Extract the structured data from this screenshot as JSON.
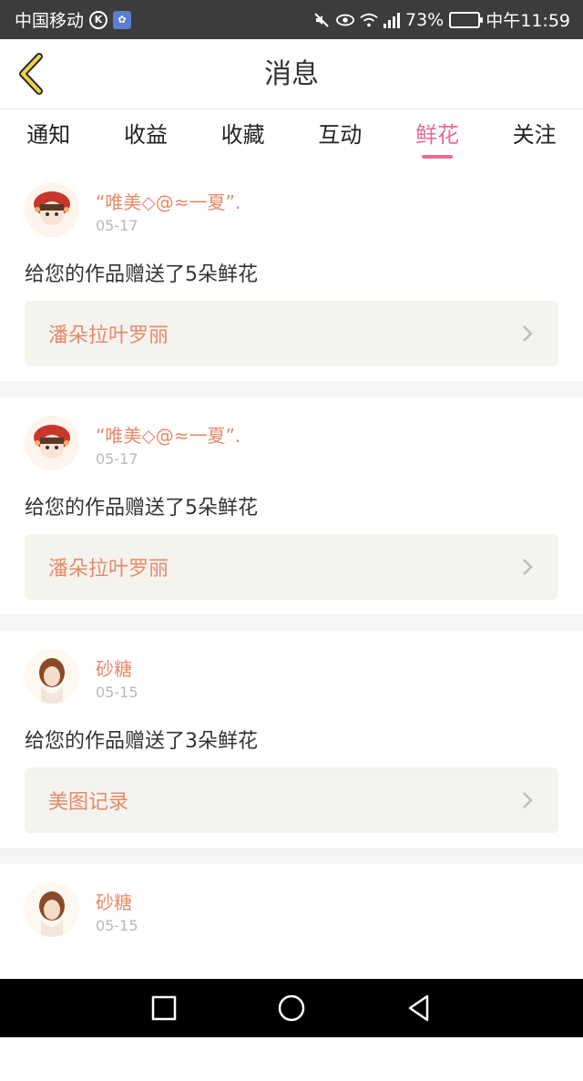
{
  "status_bar": {
    "carrier": "中国移动",
    "battery_percent": "73%",
    "battery_level": 0.73,
    "network": "4G",
    "time": "中午11:59"
  },
  "header": {
    "title": "消息"
  },
  "tabs": [
    {
      "label": "通知",
      "active": false
    },
    {
      "label": "收益",
      "active": false
    },
    {
      "label": "收藏",
      "active": false
    },
    {
      "label": "互动",
      "active": false
    },
    {
      "label": "鲜花",
      "active": true
    },
    {
      "label": "关注",
      "active": false
    }
  ],
  "messages": [
    {
      "user": "“唯美◇@≈一夏”.",
      "date": "05-17",
      "text": "给您的作品赠送了5朵鲜花",
      "work": "潘朵拉叶罗丽",
      "avatar": "avatar-red-hat"
    },
    {
      "user": "“唯美◇@≈一夏”.",
      "date": "05-17",
      "text": "给您的作品赠送了5朵鲜花",
      "work": "潘朵拉叶罗丽",
      "avatar": "avatar-red-hat"
    },
    {
      "user": "砂糖",
      "date": "05-15",
      "text": "给您的作品赠送了3朵鲜花",
      "work": "美图记录",
      "avatar": "avatar-girl"
    },
    {
      "user": "砂糖",
      "date": "05-15",
      "text": "",
      "work": "",
      "avatar": "avatar-girl"
    }
  ],
  "colors": {
    "accent": "#e86a96",
    "name": "#e8896a",
    "work_bg": "#f4f3ee"
  }
}
